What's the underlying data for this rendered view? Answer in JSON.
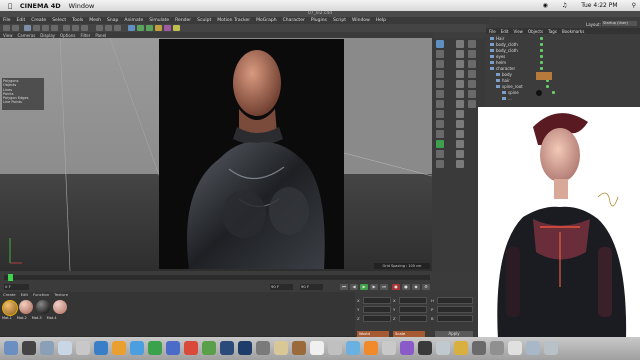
{
  "menubar": {
    "app_name": "CINEMA 4D",
    "items": [
      "Window"
    ],
    "clock": "Tue 4:22 PM"
  },
  "window": {
    "title": "07_lil2.c4d"
  },
  "c4d_menu": [
    "File",
    "Edit",
    "Create",
    "Select",
    "Tools",
    "Mesh",
    "Snap",
    "Animate",
    "Simulate",
    "Render",
    "Sculpt",
    "Motion Tracker",
    "MoGraph",
    "Character",
    "Plugins",
    "Script",
    "Window",
    "Help"
  ],
  "viewport_menu": [
    "View",
    "Cameras",
    "Display",
    "Options",
    "Filter",
    "Panel"
  ],
  "viewport_hud": "Grid Spacing : 100 cm",
  "object_manager": {
    "tabs": [
      "File",
      "Edit",
      "View",
      "Objects",
      "Tags",
      "Bookmarks"
    ],
    "layout_label": "Layout:",
    "layout_value": "Startup (User)",
    "objects": [
      "Hair",
      "body_cloth",
      "body_cloth",
      "eyes",
      "helm",
      "character",
      "body",
      "hair",
      "spine_root",
      "spine",
      "..."
    ]
  },
  "timeline": {
    "frame_start": "0 F",
    "frame_current": "90 F",
    "frame_end": "90 F"
  },
  "material_manager": {
    "menu": [
      "Create",
      "Edit",
      "Function",
      "Texture"
    ],
    "materials": [
      "Mat.1",
      "Mat.2",
      "Mat.3",
      "Mat.4"
    ],
    "status": "00:00:00  Add Camera Object"
  },
  "coordinates": {
    "labels": [
      "X",
      "Y",
      "Z",
      "X",
      "Y",
      "Z",
      "H",
      "P",
      "B"
    ],
    "world_select": "World",
    "scale_select": "Scale",
    "apply_label": "Apply"
  },
  "colors": {
    "playhead": "#3fd34d",
    "selection_orange": "#a65a32",
    "viewport_bg": "#8a8a8a"
  }
}
